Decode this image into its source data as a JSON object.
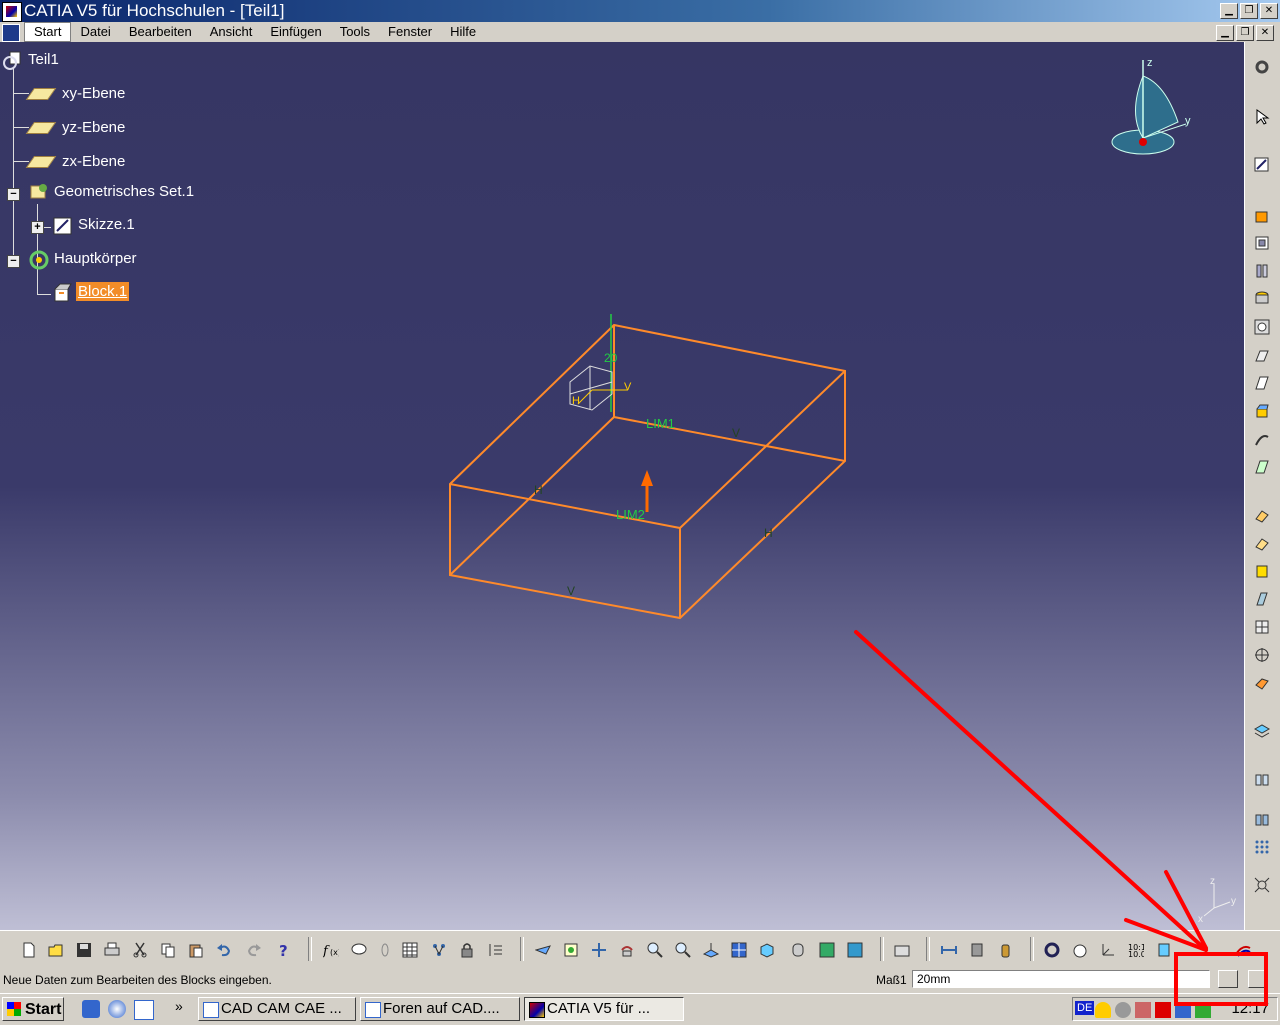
{
  "window": {
    "title": "CATIA V5 für Hochschulen - [Teil1]"
  },
  "menu": {
    "items": [
      "Start",
      "Datei",
      "Bearbeiten",
      "Ansicht",
      "Einfügen",
      "Tools",
      "Fenster",
      "Hilfe"
    ]
  },
  "tree": {
    "root": "Teil1",
    "xy": "xy-Ebene",
    "yz": "yz-Ebene",
    "zx": "zx-Ebene",
    "geoset": "Geometrisches Set.1",
    "sketch": "Skizze.1",
    "body": "Hauptkörper",
    "block": "Block.1"
  },
  "model": {
    "height_label": "20",
    "lim1": "LIM1",
    "lim2": "LIM2",
    "h1": "H",
    "h2": "H",
    "v1": "V",
    "v2": "V",
    "local_v": "V",
    "local_h": "H"
  },
  "compass": {
    "z": "z",
    "y": "y"
  },
  "small_axis": {
    "z": "z",
    "y": "y",
    "x": "x"
  },
  "status": {
    "message": "Neue Daten zum Bearbeiten des Blocks eingeben.",
    "dim_label": "Maß1",
    "dim_value": "20mm"
  },
  "taskbar": {
    "start": "Start",
    "chevron": "»",
    "tasks": [
      "CAD CAM CAE ...",
      "Foren auf CAD....",
      "CATIA V5 für ..."
    ],
    "lang": "DE",
    "clock": "12:17"
  },
  "colors": {
    "accent": "#f28c28",
    "annotation": "#ff0000",
    "dim_text": "#22cc44"
  }
}
